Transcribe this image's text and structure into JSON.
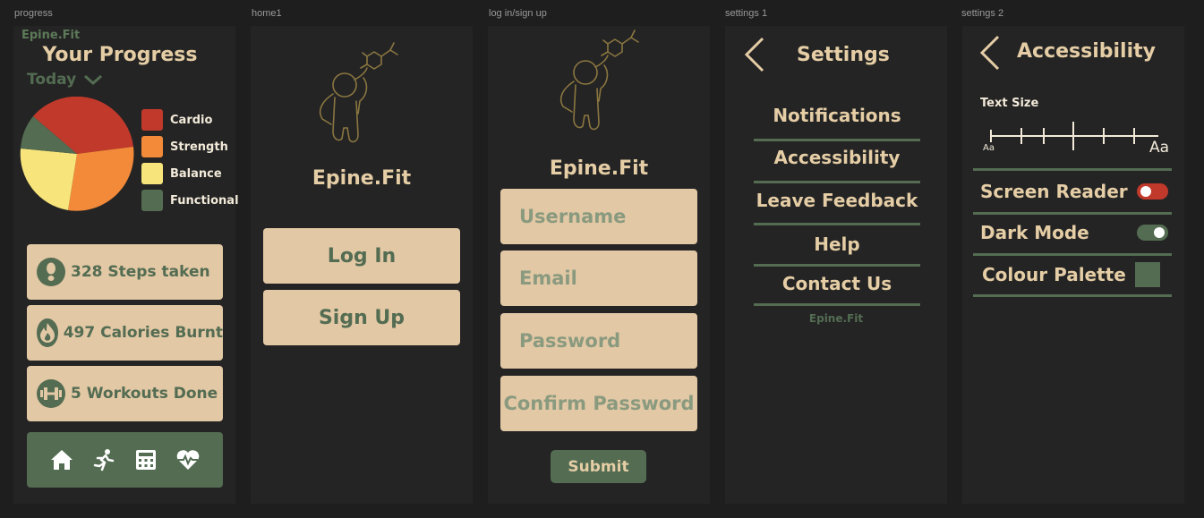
{
  "frames": {
    "progress_label": "progress",
    "home_label": "home1",
    "login_label": "log in/sign up",
    "settings1_label": "settings 1",
    "settings2_label": "settings 2"
  },
  "progress": {
    "brand": "Epine.Fit",
    "title": "Your Progress",
    "period": "Today",
    "legend": [
      {
        "label": "Cardio",
        "color": "#c0392b"
      },
      {
        "label": "Strength",
        "color": "#f28a3a"
      },
      {
        "label": "Balance",
        "color": "#f7e57b"
      },
      {
        "label": "Functional",
        "color": "#536c52"
      }
    ],
    "stats": [
      {
        "text": "328 Steps taken",
        "icon": "footprint-icon"
      },
      {
        "text": "497 Calories Burnt",
        "icon": "flame-icon"
      },
      {
        "text": "5 Workouts Done",
        "icon": "dumbbell-icon"
      }
    ],
    "nav": [
      "home-icon",
      "running-icon",
      "calculator-icon",
      "heart-pulse-icon"
    ]
  },
  "home": {
    "brand": "Epine.Fit",
    "login_label": "Log In",
    "signup_label": "Sign Up"
  },
  "login": {
    "brand": "Epine.Fit",
    "username_placeholder": "Username",
    "email_placeholder": "Email",
    "password_placeholder": "Password",
    "confirm_placeholder": "Confirm Password",
    "submit_label": "Submit"
  },
  "settings1": {
    "title": "Settings",
    "items": [
      "Notifications",
      "Accessibility",
      "Leave Feedback",
      "Help",
      "Contact Us"
    ],
    "brand": "Epine.Fit"
  },
  "settings2": {
    "title": "Accessibility",
    "text_size_label": "Text Size",
    "aa_small": "Aa",
    "aa_large": "Aa",
    "screen_reader_label": "Screen Reader",
    "screen_reader_on": false,
    "dark_mode_label": "Dark Mode",
    "dark_mode_on": true,
    "palette_label": "Colour Palette",
    "palette_color": "#536c52"
  },
  "colors": {
    "beige": "#e2c8a5",
    "green": "#536c52",
    "toggle_red": "#c0392b",
    "background": "#242424"
  }
}
